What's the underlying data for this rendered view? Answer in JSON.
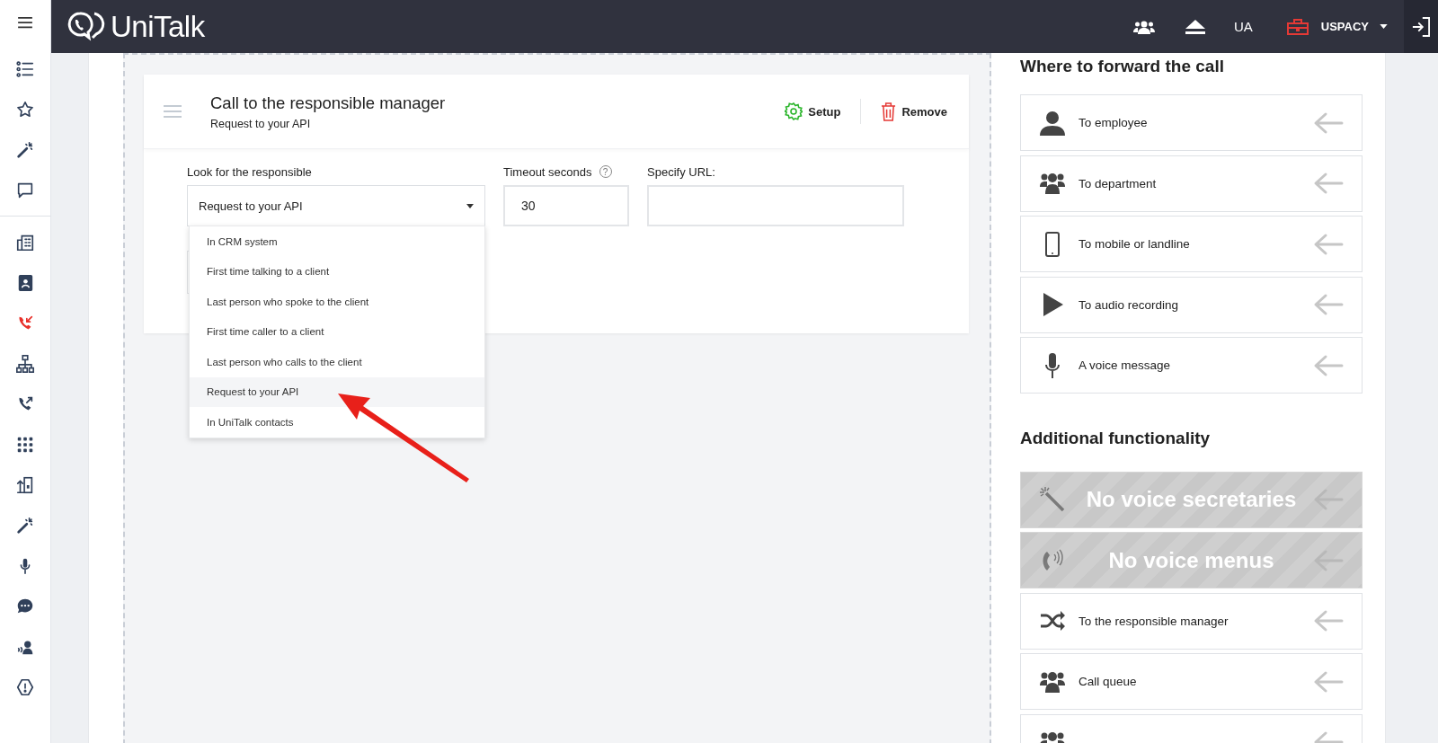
{
  "sidebar": {
    "items": [
      {
        "kind": "list",
        "selected": false
      },
      {
        "kind": "star",
        "selected": false
      },
      {
        "kind": "wand",
        "selected": false
      },
      {
        "kind": "chat",
        "selected": false
      },
      {
        "kind": "building",
        "selected": false
      },
      {
        "kind": "contacts",
        "selected": false
      },
      {
        "kind": "incoming",
        "selected": true
      },
      {
        "kind": "org",
        "selected": false
      },
      {
        "kind": "outgoing",
        "selected": false
      },
      {
        "kind": "grid",
        "selected": false
      },
      {
        "kind": "transfer",
        "selected": false
      },
      {
        "kind": "wand",
        "selected": false
      },
      {
        "kind": "mic",
        "selected": false
      },
      {
        "kind": "bubble",
        "selected": false
      },
      {
        "kind": "speaker",
        "selected": false
      },
      {
        "kind": "alert",
        "selected": false
      }
    ]
  },
  "topbar": {
    "logo": "UniTalk",
    "language": "UA",
    "account": "USPACY"
  },
  "card": {
    "title": "Call to the responsible manager",
    "subtitle": "Request to your API",
    "actions": [
      {
        "kind": "setup",
        "label": "Setup"
      },
      {
        "kind": "remove",
        "label": "Remove"
      }
    ],
    "responsible": {
      "label": "Look for the responsible",
      "value": "Request to your API",
      "expanded": true,
      "options": [
        {
          "label": "In CRM system",
          "selected": false
        },
        {
          "label": "First time talking to a client",
          "selected": false
        },
        {
          "label": "Last person who spoke to the client",
          "selected": false
        },
        {
          "label": "First time caller to a client",
          "selected": false
        },
        {
          "label": "Last person who calls to the client",
          "selected": false
        },
        {
          "label": "Request to your API",
          "selected": true
        },
        {
          "label": "In UniTalk contacts",
          "selected": false
        }
      ]
    },
    "timeout": {
      "label": "Timeout seconds",
      "help": "?",
      "value": "30"
    },
    "url": {
      "label": "Specify URL:"
    }
  },
  "forward": {
    "heading": "Where to forward the call",
    "items": [
      {
        "kind": "employee",
        "label": "To employee",
        "disabled": false
      },
      {
        "kind": "department",
        "label": "To department",
        "disabled": false
      },
      {
        "kind": "mobile",
        "label": "To mobile or landline",
        "disabled": false
      },
      {
        "kind": "play",
        "label": "To audio recording",
        "disabled": false
      },
      {
        "kind": "mic",
        "label": "A voice message",
        "disabled": false
      }
    ]
  },
  "additional": {
    "heading": "Additional functionality",
    "items": [
      {
        "kind": "wand",
        "overlay": "No voice secretaries",
        "disabled": true
      },
      {
        "kind": "ivr",
        "overlay": "No voice menus",
        "disabled": true
      },
      {
        "kind": "shuffle",
        "label": "To the responsible manager",
        "disabled": false
      },
      {
        "kind": "department",
        "label": "Call queue",
        "disabled": false
      },
      {
        "kind": "department",
        "disabled": false
      }
    ]
  }
}
